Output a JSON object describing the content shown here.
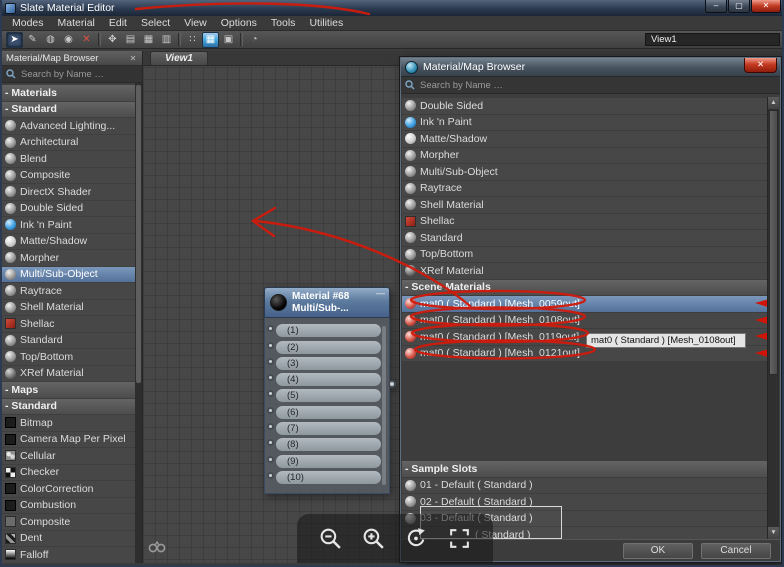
{
  "colors": {
    "annotation_red": "#d11a0c",
    "selection_blue": "#53719a",
    "node_header_blue": "#5c7b9e"
  },
  "titlebar": {
    "title": "Slate Material Editor",
    "minimize_glyph": "–",
    "maximize_glyph": "▢",
    "close_glyph": "✕"
  },
  "menubar": {
    "items": [
      {
        "name": "menu-modes",
        "label": "Modes"
      },
      {
        "name": "menu-material",
        "label": "Material"
      },
      {
        "name": "menu-edit",
        "label": "Edit"
      },
      {
        "name": "menu-select",
        "label": "Select"
      },
      {
        "name": "menu-view",
        "label": "View"
      },
      {
        "name": "menu-options",
        "label": "Options"
      },
      {
        "name": "menu-tools",
        "label": "Tools"
      },
      {
        "name": "menu-utilities",
        "label": "Utilities"
      }
    ]
  },
  "toolbar": {
    "view_selector": "View1",
    "buttons": [
      {
        "name": "select-tool-button",
        "glyph": "➤",
        "state": "active",
        "inter": "true"
      },
      {
        "name": "pick-material-from-object-button",
        "glyph": "✎",
        "inter": "true"
      },
      {
        "name": "put-material-to-scene-button",
        "glyph": "◍",
        "inter": "true"
      },
      {
        "name": "assign-material-to-selection-button",
        "glyph": "◉",
        "inter": "true"
      },
      {
        "name": "delete-selected-button",
        "glyph": "✕",
        "state": "red",
        "inter": "true"
      },
      {
        "name": "toolbar-divider",
        "type": "divider",
        "glyph": "",
        "inter": "false"
      },
      {
        "name": "move-children-button",
        "glyph": "✥",
        "inter": "true"
      },
      {
        "name": "hide-unused-nodeslots-button",
        "glyph": "▤",
        "inter": "true"
      },
      {
        "name": "layout-all-button",
        "glyph": "▦",
        "inter": "true"
      },
      {
        "name": "layout-children-button",
        "glyph": "▥",
        "inter": "true"
      },
      {
        "name": "toolbar-divider",
        "type": "divider",
        "glyph": "",
        "inter": "false"
      },
      {
        "name": "material-id-channel-button",
        "glyph": "∷",
        "inter": "true"
      },
      {
        "name": "show-shaded-material-in-viewport-button",
        "glyph": "▦",
        "state": "active-blue",
        "inter": "true"
      },
      {
        "name": "show-background-button",
        "glyph": "▣",
        "inter": "true"
      },
      {
        "name": "toolbar-divider",
        "type": "divider",
        "glyph": "",
        "inter": "false"
      },
      {
        "name": "options-button",
        "glyph": "◔",
        "inter": "true"
      }
    ]
  },
  "left_panel": {
    "title": "Material/Map Browser",
    "close_glyph": "✕",
    "search_placeholder": "Search by Name …",
    "rows": [
      {
        "type": "header",
        "label": "- Materials"
      },
      {
        "type": "subheader",
        "label": "- Standard"
      },
      {
        "type": "item",
        "icon": "sphere-gray",
        "label": "Advanced Lighting..."
      },
      {
        "type": "item",
        "icon": "sphere-gray",
        "label": "Architectural"
      },
      {
        "type": "item",
        "icon": "sphere-gray",
        "label": "Blend"
      },
      {
        "type": "item",
        "icon": "sphere-gray",
        "label": "Composite"
      },
      {
        "type": "item",
        "icon": "sphere-gray",
        "label": "DirectX Shader"
      },
      {
        "type": "item",
        "icon": "sphere-gray",
        "label": "Double Sided"
      },
      {
        "type": "item",
        "icon": "sphere-blue",
        "label": "Ink 'n Paint"
      },
      {
        "type": "item",
        "icon": "sphere-light",
        "label": "Matte/Shadow"
      },
      {
        "type": "item",
        "icon": "sphere-gray",
        "label": "Morpher"
      },
      {
        "type": "item",
        "icon": "sphere-gray",
        "label": "Multi/Sub-Object",
        "state": "selected"
      },
      {
        "type": "item",
        "icon": "sphere-gray",
        "label": "Raytrace"
      },
      {
        "type": "item",
        "icon": "sphere-gray",
        "label": "Shell Material"
      },
      {
        "type": "item",
        "icon": "square-red",
        "label": "Shellac"
      },
      {
        "type": "item",
        "icon": "sphere-gray",
        "label": "Standard"
      },
      {
        "type": "item",
        "icon": "sphere-gray",
        "label": "Top/Bottom"
      },
      {
        "type": "item",
        "icon": "sphere-dark",
        "label": "XRef Material"
      },
      {
        "type": "header",
        "label": "- Maps"
      },
      {
        "type": "subheader",
        "label": "- Standard"
      },
      {
        "type": "item",
        "icon": "sq-dark",
        "label": "Bitmap"
      },
      {
        "type": "item",
        "icon": "sq-dark",
        "label": "Camera Map Per Pixel"
      },
      {
        "type": "item",
        "icon": "sq-cellular",
        "label": "Cellular"
      },
      {
        "type": "item",
        "icon": "sq-checker",
        "label": "Checker"
      },
      {
        "type": "item",
        "icon": "sq-dark",
        "label": "ColorCorrection"
      },
      {
        "type": "item",
        "icon": "sq-dark",
        "label": "Combustion"
      },
      {
        "type": "item",
        "icon": "sq-gray",
        "label": "Composite"
      },
      {
        "type": "item",
        "icon": "sq-dent",
        "label": "Dent"
      },
      {
        "type": "item",
        "icon": "sq-falloff",
        "label": "Falloff"
      }
    ]
  },
  "canvas": {
    "tab": "View1",
    "node": {
      "title": "Material #68",
      "subtitle": "Multi/Sub-...",
      "collapse_glyph": "—",
      "slots": [
        "(1)",
        "(2)",
        "(3)",
        "(4)",
        "(5)",
        "(6)",
        "(7)",
        "(8)",
        "(9)",
        "(10)"
      ]
    }
  },
  "dialog": {
    "title": "Material/Map Browser",
    "close_glyph": "✕",
    "search_placeholder": "Search by Name …",
    "scroll_up_glyph": "▲",
    "scroll_down_glyph": "▼",
    "types": [
      {
        "icon": "sphere-gray",
        "label": "Double Sided"
      },
      {
        "icon": "sphere-blue",
        "label": "Ink 'n Paint"
      },
      {
        "icon": "sphere-light",
        "label": "Matte/Shadow"
      },
      {
        "icon": "sphere-gray",
        "label": "Morpher"
      },
      {
        "icon": "sphere-gray",
        "label": "Multi/Sub-Object"
      },
      {
        "icon": "sphere-gray",
        "label": "Raytrace"
      },
      {
        "icon": "sphere-gray",
        "label": "Shell Material"
      },
      {
        "icon": "square-red",
        "label": "Shellac"
      },
      {
        "icon": "sphere-gray",
        "label": "Standard"
      },
      {
        "icon": "sphere-gray",
        "label": "Top/Bottom"
      },
      {
        "icon": "sphere-dark",
        "label": "XRef Material"
      }
    ],
    "scene_header": "- Scene Materials",
    "scene_materials": [
      {
        "icon": "sphere-red",
        "label": "mat0 ( Standard ) [Mesh_0059out]",
        "state": "selected"
      },
      {
        "icon": "sphere-red",
        "label": "mat0 ( Standard ) [Mesh_0108out]"
      },
      {
        "icon": "sphere-red",
        "label": "mat0 ( Standard ) [Mesh_0119out]"
      },
      {
        "icon": "sphere-red",
        "label": "mat0 ( Standard ) [Mesh_0121out]"
      }
    ],
    "sample_header": "- Sample Slots",
    "sample_slots": [
      {
        "icon": "sphere-gray",
        "label": "01 - Default ( Standard )"
      },
      {
        "icon": "sphere-gray",
        "label": "02 - Default ( Standard )"
      },
      {
        "icon": "sphere-gray",
        "label": "03 - Default ( Standard )"
      },
      {
        "icon": "sphere-gray",
        "label": "( Standard )",
        "state": "partial"
      }
    ],
    "tooltip": "mat0 ( Standard ) [Mesh_0108out]",
    "ok_label": "OK",
    "cancel_label": "Cancel"
  }
}
